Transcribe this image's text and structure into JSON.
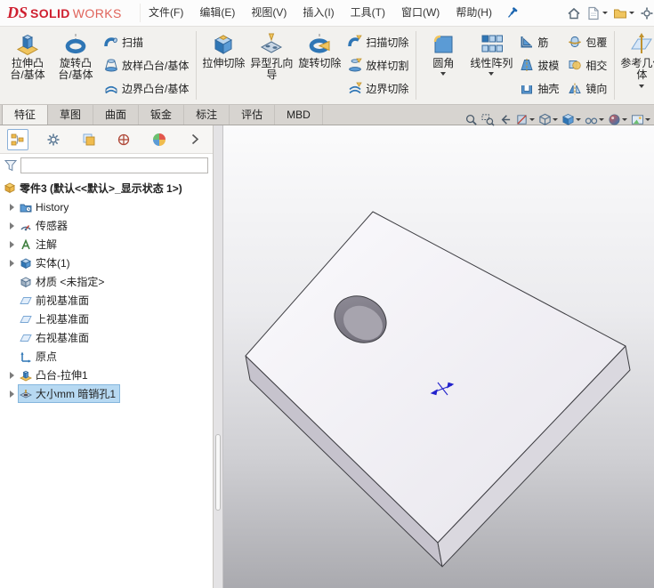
{
  "logo": {
    "mark": "DS",
    "brand_bold": "SOLID",
    "brand_light": "WORKS"
  },
  "menu": {
    "items": [
      "文件(F)",
      "编辑(E)",
      "视图(V)",
      "插入(I)",
      "工具(T)",
      "窗口(W)",
      "帮助(H)"
    ]
  },
  "ribbon": {
    "big": [
      {
        "label": "拉伸凸台/基体"
      },
      {
        "label": "旋转凸台/基体"
      },
      {
        "label": "拉伸切除"
      },
      {
        "label": "异型孔向导"
      },
      {
        "label": "旋转切除"
      },
      {
        "label": "圆角",
        "dropdown": true
      },
      {
        "label": "线性阵列",
        "dropdown": true
      },
      {
        "label": "参考几何体",
        "dropdown": true
      }
    ],
    "small": [
      {
        "label": "扫描"
      },
      {
        "label": "放样凸台/基体"
      },
      {
        "label": "边界凸台/基体"
      },
      {
        "label": "扫描切除"
      },
      {
        "label": "放样切割"
      },
      {
        "label": "边界切除"
      },
      {
        "label": "筋"
      },
      {
        "label": "拔模"
      },
      {
        "label": "抽壳"
      },
      {
        "label": "包覆"
      },
      {
        "label": "相交"
      },
      {
        "label": "镜向"
      }
    ]
  },
  "tabs": {
    "items": [
      "特征",
      "草图",
      "曲面",
      "钣金",
      "标注",
      "评估",
      "MBD"
    ],
    "active": "特征"
  },
  "feature_tree": {
    "root": "零件3 (默认<<默认>_显示状态 1>)",
    "filter_value": "",
    "items": [
      {
        "label": "History"
      },
      {
        "label": "传感器"
      },
      {
        "label": "注解"
      },
      {
        "label": "实体(1)"
      },
      {
        "label": "材质 <未指定>"
      },
      {
        "label": "前视基准面"
      },
      {
        "label": "上视基准面"
      },
      {
        "label": "右视基准面"
      },
      {
        "label": "原点"
      },
      {
        "label": "凸台-拉伸1"
      },
      {
        "label": "大小mm 暗销孔1",
        "selected": true
      }
    ]
  },
  "headsup_tools": [
    "zoom-fit",
    "zoom-area",
    "previous-view",
    "section-view",
    "view-orientation",
    "display-style",
    "hide-show-items",
    "edit-appearance",
    "apply-scene"
  ],
  "icons": {
    "menu_pin": "pushpin",
    "window_icons": [
      "home",
      "new-document",
      "open-document",
      "options"
    ]
  },
  "colors": {
    "brand_red": "#cf2030",
    "selection_blue": "#b7d9f2",
    "accent_blue": "#1d66b0"
  }
}
